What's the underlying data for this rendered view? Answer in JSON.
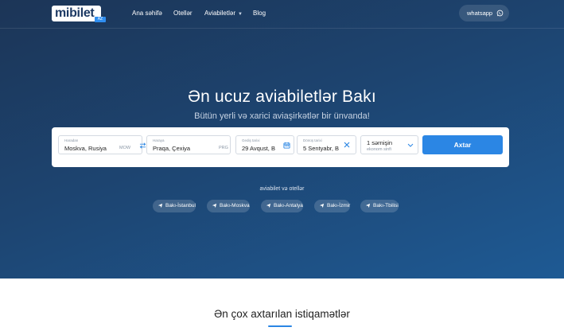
{
  "brand": {
    "logo_text": "mibilet",
    "logo_badge": "AZ"
  },
  "nav": {
    "items": [
      {
        "label": "Ana səhifə"
      },
      {
        "label": "Otellər"
      },
      {
        "label": "Aviabiletlər"
      },
      {
        "label": "Blog"
      }
    ],
    "whatsapp_label": "whatsapp"
  },
  "hero": {
    "title": "Ən ucuz aviabiletlər Bakı",
    "subtitle": "Bütün yerli və xarici aviaşirkətlər bir ünvanda!"
  },
  "search": {
    "from": {
      "label": "Haradan",
      "value": "Moskva, Rusiya",
      "code": "MOW"
    },
    "to": {
      "label": "Haraya",
      "value": "Praqa, Çexiya",
      "code": "PRG"
    },
    "depart": {
      "label": "Gediş tarixi",
      "value": "29 Avqust, B"
    },
    "return": {
      "label": "Dönüş tarixi",
      "value": "5 Sentyabr, B"
    },
    "passengers": {
      "value": "1 sərnişin",
      "class": "ekonom sinfi"
    },
    "button_label": "Axtar"
  },
  "popular": {
    "title": "aviabilet və otellər",
    "chips": [
      {
        "label": "Bakı-İstanbul"
      },
      {
        "label": "Bakı-Moskva"
      },
      {
        "label": "Bakı-Antalya"
      },
      {
        "label": "Bakı-İzmir"
      },
      {
        "label": "Bakı-Tbilisi"
      }
    ]
  },
  "section": {
    "title": "Ən çox axtarılan istiqamətlər"
  },
  "colors": {
    "accent": "#2b86e4",
    "hero_dark": "#1c3557",
    "hero_light": "#1e5a94"
  }
}
